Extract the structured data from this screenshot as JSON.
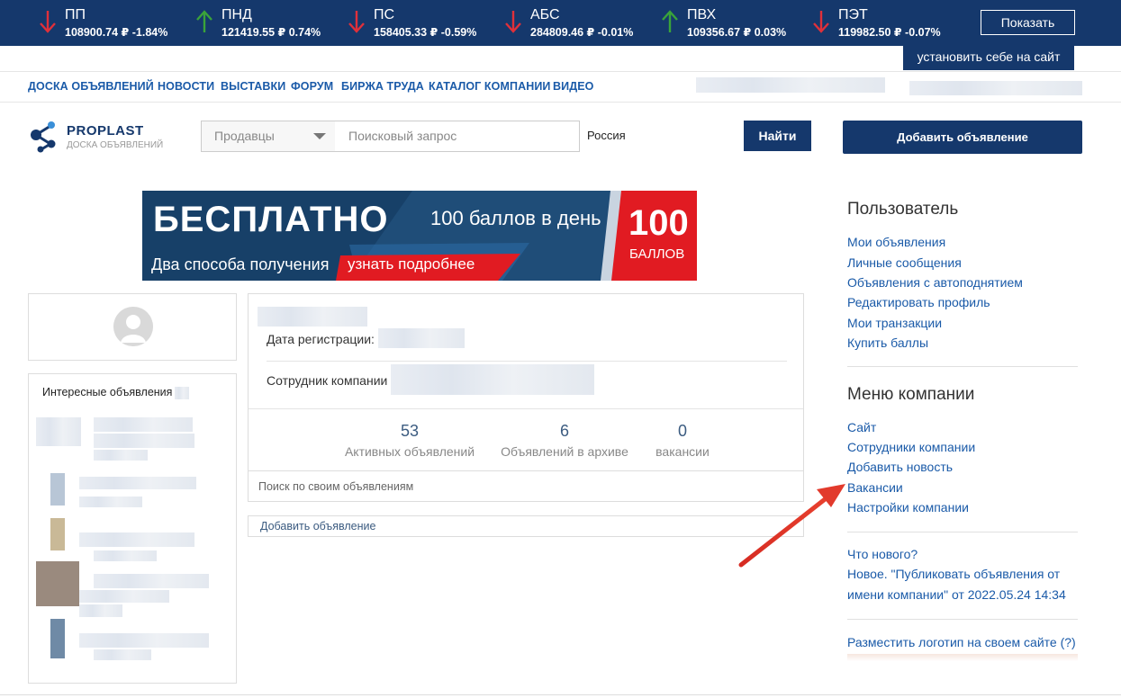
{
  "ticker": {
    "items": [
      {
        "name": "ПП",
        "value": "108900.74 ₽ -1.84%",
        "direction": "down"
      },
      {
        "name": "ПНД",
        "value": "121419.55 ₽ 0.74%",
        "direction": "up"
      },
      {
        "name": "ПС",
        "value": "158405.33 ₽ -0.59%",
        "direction": "down"
      },
      {
        "name": "АБС",
        "value": "284809.46 ₽ -0.01%",
        "direction": "down"
      },
      {
        "name": "ПВХ",
        "value": "109356.67 ₽ 0.03%",
        "direction": "up"
      },
      {
        "name": "ПЭТ",
        "value": "119982.50 ₽ -0.07%",
        "direction": "down"
      }
    ],
    "show_label": "Показать",
    "install_label": "установить себе на сайт",
    "colors": {
      "bg": "#15386c",
      "up": "#3aa33a",
      "down": "#e0303a"
    }
  },
  "nav": {
    "items": [
      "ДОСКА ОБЪЯВЛЕНИЙ",
      "НОВОСТИ",
      "ВЫСТАВКИ",
      "ФОРУМ",
      "БИРЖА ТРУДА",
      "КАТАЛОГ КОМПАНИИ",
      "ВИДЕО"
    ]
  },
  "header": {
    "brand": "PROPLAST",
    "brand_sub": "ДОСКА ОБЪЯВЛЕНИЙ",
    "select_value": "Продавцы",
    "search_placeholder": "Поисковый запрос",
    "region_value": "Россия",
    "find_label": "Найти",
    "add_label": "Добавить объявление"
  },
  "banner": {
    "free": "БЕСПЛАТНО",
    "points_per_day": "100 баллов в день",
    "ways": "Два способа получения",
    "more": "узнать подробнее",
    "num": "100",
    "unit": "БАЛЛОВ"
  },
  "left": {
    "interesting_title": "Интересные объявления"
  },
  "profile": {
    "reg_label": "Дата регистрации:",
    "employee_label": "Сотрудник компании",
    "stats": [
      {
        "num": "53",
        "caption": "Активных объявлений"
      },
      {
        "num": "6",
        "caption": "Объявлений в архиве"
      },
      {
        "num": "0",
        "caption": "вакансии"
      }
    ],
    "own_search_placeholder": "Поиск по своим объявлениям",
    "add_link": "Добавить объявление"
  },
  "sidebar": {
    "user_title": "Пользователь",
    "user_links": [
      "Мои объявления",
      "Личные сообщения",
      "Объявления с автоподнятием",
      "Редактировать профиль",
      "Мои транзакции",
      "Купить баллы"
    ],
    "company_title": "Меню компании",
    "company_links": [
      "Сайт",
      "Сотрудники компании",
      "Добавить новость",
      "Вакансии",
      "Настройки компании"
    ],
    "whats_new": "Что нового?",
    "news_line1": "Новое. \"Публиковать объявления от",
    "news_line2": "имени компании\" от 2022.05.24 14:34",
    "logo_link": "Разместить логотип на своем сайте (?)"
  }
}
